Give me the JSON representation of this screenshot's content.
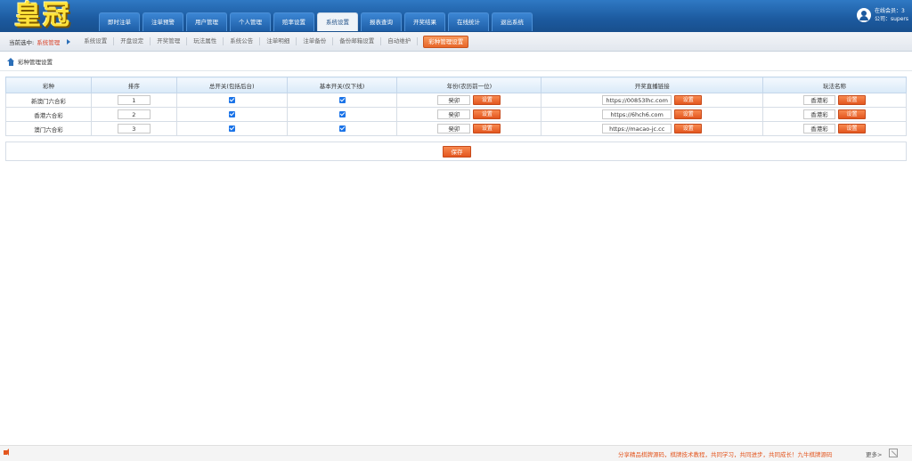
{
  "header": {
    "logo": "皇冠",
    "nav": [
      "即时注单",
      "注单预警",
      "用户管理",
      "个人管理",
      "赔率设置",
      "系统设置",
      "报表查询",
      "开奖结果",
      "在线统计",
      "退出系统"
    ],
    "active_nav": "系统设置",
    "online_label": "在线会员：3",
    "account_label": "公司：supers"
  },
  "subnav": {
    "current_label": "当前选中:",
    "current_value": "系统管理",
    "items": [
      "系统设置",
      "开盘设定",
      "开奖管理",
      "玩法属性",
      "系统公告",
      "注单明细",
      "注单备份",
      "备份邮箱设置",
      "自动维护"
    ],
    "active_item": "彩种管理设置"
  },
  "breadcrumb": "彩种管理设置",
  "table": {
    "headers": [
      "彩种",
      "排序",
      "总开关(包括后台)",
      "基本开关(仅下线)",
      "年份(农历前一位)",
      "开奖直播链接",
      "玩法名称"
    ],
    "set_label": "设置",
    "rows": [
      {
        "name": "新澳门六合彩",
        "order": "1",
        "year": "癸卯",
        "url": "https://00853lhc.com",
        "play": "香港彩",
        "total_on": true,
        "basic_on": true
      },
      {
        "name": "香港六合彩",
        "order": "2",
        "year": "癸卯",
        "url": "https://6hch6.com",
        "play": "香港彩",
        "total_on": true,
        "basic_on": true
      },
      {
        "name": "澳门六合彩",
        "order": "3",
        "year": "癸卯",
        "url": "https://macao-jc.cc",
        "play": "香港彩",
        "total_on": true,
        "basic_on": true
      }
    ]
  },
  "save_label": "保存",
  "footer": {
    "marquee": "分享精品棋牌源码，棋牌技术教程，共同学习，共同进步，共同成长！九牛棋牌源码",
    "more": "更多>"
  }
}
